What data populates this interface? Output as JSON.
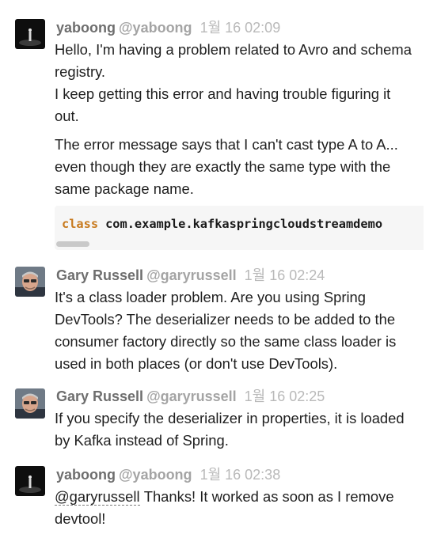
{
  "messages": [
    {
      "author": "yaboong",
      "handle": "@yaboong",
      "time": "1월 16 02:09",
      "avatar": "dark-stage-avatar",
      "paragraphs": [
        [
          "Hello, I'm having a problem related to Avro and schema",
          "registry.",
          "I keep getting this error and having trouble figuring it",
          "out."
        ],
        [
          "The error message says that I can't cast type A to A...",
          "even though they are exactly the same type with the",
          "same package name."
        ]
      ],
      "code": {
        "keyword": "class",
        "text": "com.example.kafkaspringcloudstreamdemo"
      }
    },
    {
      "author": "Gary Russell",
      "handle": "@garyrussell",
      "time": "1월 16 02:24",
      "avatar": "person-photo-avatar",
      "lines": [
        "It's a class loader problem. Are you using Spring",
        "DevTools? The deserializer needs to be added to the",
        "consumer factory directly so the same class loader is",
        "used in both places (or don't use DevTools)."
      ]
    },
    {
      "author": "Gary Russell",
      "handle": "@garyrussell",
      "time": "1월 16 02:25",
      "avatar": "person-photo-avatar",
      "lines": [
        "If you specify the deserializer in properties, it is loaded",
        "by Kafka instead of Spring."
      ]
    },
    {
      "author": "yaboong",
      "handle": "@yaboong",
      "time": "1월 16 02:38",
      "avatar": "dark-stage-avatar",
      "mention": "@garyrussell",
      "lines": [
        "Thanks! It worked as soon as I remove",
        "devtool!"
      ]
    }
  ]
}
